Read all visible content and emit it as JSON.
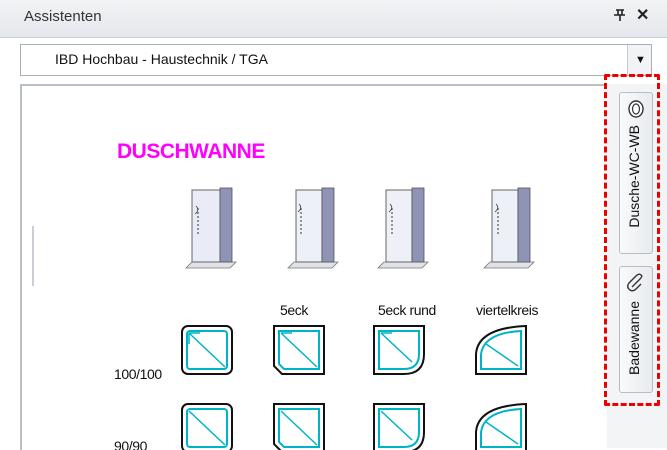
{
  "window": {
    "title": "Assistenten",
    "pin_icon": "pin-icon",
    "close_icon": "close-icon"
  },
  "dropdown": {
    "value": "IBD Hochbau - Haustechnik / TGA"
  },
  "content": {
    "heading": "DUSCHWANNE",
    "columns": [
      "",
      "5eck",
      "5eck rund",
      "viertelkreis"
    ],
    "rows": [
      "100/100",
      "90/90"
    ]
  },
  "tabs": [
    {
      "label": "Dusche-WC-WB",
      "icon": "toilet-icon"
    },
    {
      "label": "Badewanne",
      "icon": "paperclip-icon"
    }
  ],
  "colors": {
    "heading": "#ff00ff",
    "tray_outline": "#00b4c8",
    "highlight": "#ee0000"
  }
}
